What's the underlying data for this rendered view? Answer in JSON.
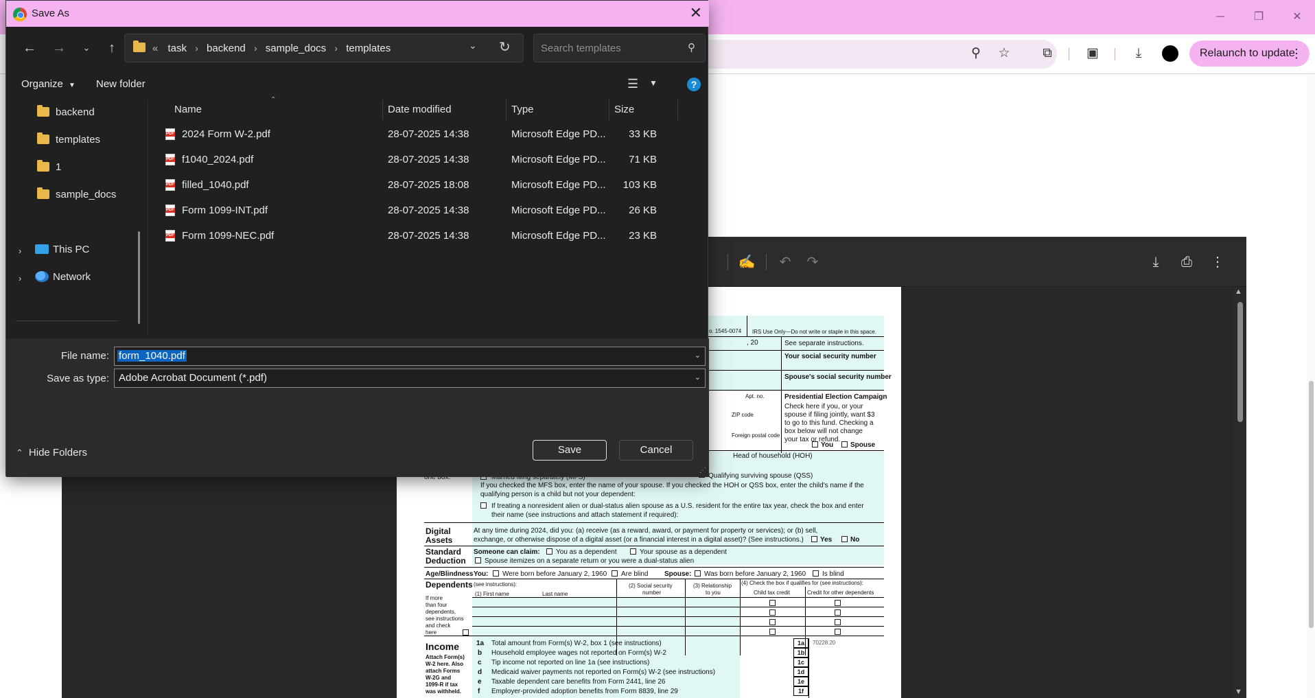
{
  "dialog": {
    "title": "Save As",
    "breadcrumb_prefix": "«",
    "breadcrumbs": [
      "task",
      "backend",
      "sample_docs",
      "templates"
    ],
    "search_placeholder": "Search templates",
    "organize_label": "Organize",
    "new_folder_label": "New folder",
    "help_label": "?",
    "nav_items": [
      {
        "label": "backend",
        "icon": "folder-icon"
      },
      {
        "label": "templates",
        "icon": "folder-icon"
      },
      {
        "label": "1",
        "icon": "folder-icon"
      },
      {
        "label": "sample_docs",
        "icon": "folder-icon"
      },
      {
        "label": "This PC",
        "icon": "pc-icon"
      },
      {
        "label": "Network",
        "icon": "network-icon"
      }
    ],
    "columns": [
      "Name",
      "Date modified",
      "Type",
      "Size"
    ],
    "files": [
      {
        "name": "2024 Form W-2.pdf",
        "date": "28-07-2025 14:38",
        "type": "Microsoft Edge PD...",
        "size": "33 KB"
      },
      {
        "name": "f1040_2024.pdf",
        "date": "28-07-2025 14:38",
        "type": "Microsoft Edge PD...",
        "size": "71 KB"
      },
      {
        "name": "filled_1040.pdf",
        "date": "28-07-2025 18:08",
        "type": "Microsoft Edge PD...",
        "size": "103 KB"
      },
      {
        "name": "Form 1099-INT.pdf",
        "date": "28-07-2025 14:38",
        "type": "Microsoft Edge PD...",
        "size": "26 KB"
      },
      {
        "name": "Form 1099-NEC.pdf",
        "date": "28-07-2025 14:38",
        "type": "Microsoft Edge PD...",
        "size": "23 KB"
      }
    ],
    "file_name_label": "File name:",
    "file_name_value": "form_1040.pdf",
    "save_type_label": "Save as type:",
    "save_type_value": "Adobe Acrobat Document (*.pdf)",
    "save_label": "Save",
    "cancel_label": "Cancel",
    "hide_folders_label": "Hide Folders"
  },
  "browser": {
    "relaunch_label": "Relaunch to update"
  },
  "pdf": {
    "omb": "o. 1545-0074",
    "irs_use": "IRS Use Only—Do not write or staple in this space.",
    "year_mark": ", 20",
    "see_instructions": "See separate instructions.",
    "your_ssn": "Your social security number",
    "spouse_ssn": "Spouse's social security number",
    "apt_no": "Apt. no.",
    "zip_code": "ZIP code",
    "foreign_postal": "Foreign postal code",
    "pec_title": "Presidential Election Campaign",
    "pec_text": [
      "Check here if you, or your",
      "spouse if filing jointly, want $3",
      "to go to this fund. Checking a",
      "box below will not change",
      "your tax or refund."
    ],
    "pec_you": "You",
    "pec_spouse": "Spouse",
    "hoh": "Head of household (HOH)",
    "mfs": "Married filing separately (MFS)",
    "one_box": "one box.",
    "qss": "Qualifying surviving spouse (QSS)",
    "mfs_note_1": "If you checked the MFS box, enter the name of your spouse. If you checked the HOH or QSS box, enter the child's name if the",
    "mfs_note_2": "qualifying person is a child but not your dependent:",
    "nra_1": "If treating a nonresident alien or dual-status alien spouse as a U.S. resident for the entire tax year, check the box and enter",
    "nra_2": "their name (see instructions and attach statement if required):",
    "digital_assets_1": "Digital",
    "digital_assets_2": "Assets",
    "da_text_1": "At any time during 2024, did you: (a) receive (as a reward, award, or payment for property or services); or (b) sell,",
    "da_text_2": "exchange, or otherwise dispose of a digital asset (or a financial interest in a digital asset)? (See instructions.)",
    "yes": "Yes",
    "no": "No",
    "std_ded_1": "Standard",
    "std_ded_2": "Deduction",
    "someone_can_claim": "Someone can claim:",
    "you_dependent": "You as a dependent",
    "spouse_dependent": "Your spouse as a dependent",
    "spouse_itemizes": "Spouse itemizes on a separate return or you were a dual-status alien",
    "age_blindness": "Age/Blindness",
    "you_label": "You:",
    "born_before": "Were born before January 2, 1960",
    "are_blind": "Are blind",
    "spouse_label": "Spouse:",
    "was_born_before": "Was born before January 2, 1960",
    "is_blind": "Is blind",
    "dependents": "Dependents",
    "see_instr": "(see instructions):",
    "col_first": "(1) First name",
    "col_last": "Last name",
    "col_ssn_1": "(2) Social security",
    "col_ssn_2": "number",
    "col_rel_1": "(3) Relationship",
    "col_rel_2": "to you",
    "col_check": "(4) Check the box if qualifies for (see instructions):",
    "child_credit": "Child tax credit",
    "other_credit": "Credit for other dependents",
    "more_than_four": [
      "If more",
      "than four",
      "dependents,",
      "see instructions",
      "and check",
      "here"
    ],
    "income": "Income",
    "attach_forms": [
      "Attach Form(s)",
      "W-2 here. Also",
      "attach Forms",
      "W-2G and",
      "1099-R if tax",
      "was withheld."
    ],
    "income_lines": [
      {
        "code": "1a",
        "text": "Total amount from Form(s) W-2, box 1 (see instructions)",
        "box": "1a",
        "value": "70228.20"
      },
      {
        "code": "b",
        "text": "Household employee wages not reported on Form(s) W-2",
        "box": "1b",
        "value": ""
      },
      {
        "code": "c",
        "text": "Tip income not reported on line 1a (see instructions)",
        "box": "1c",
        "value": ""
      },
      {
        "code": "d",
        "text": "Medicaid waiver payments not reported on Form(s) W-2 (see instructions)",
        "box": "1d",
        "value": ""
      },
      {
        "code": "e",
        "text": "Taxable dependent care benefits from Form 2441, line 26",
        "box": "1e",
        "value": ""
      },
      {
        "code": "f",
        "text": "Employer-provided adoption benefits from Form 8839, line 29",
        "box": "1f",
        "value": ""
      }
    ]
  }
}
